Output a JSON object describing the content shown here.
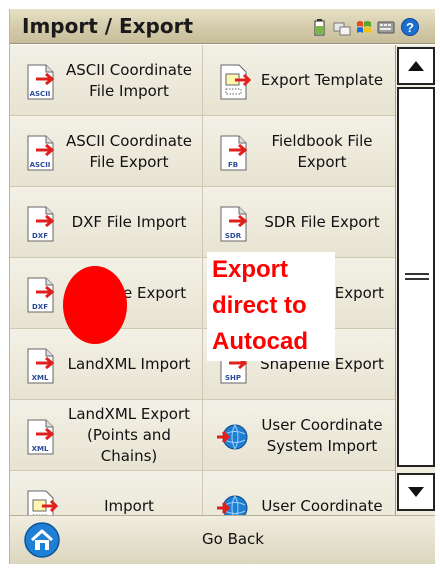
{
  "titlebar": {
    "title": "Import / Export",
    "icons": [
      "battery-icon",
      "network-icon",
      "windows-flag-icon",
      "keyboard-icon",
      "help-icon"
    ]
  },
  "grid": {
    "items": [
      {
        "label": "ASCII Coordinate File Import",
        "icon": "ascii-file-icon",
        "badge": "ASCII"
      },
      {
        "label": "Export Template",
        "icon": "template-icon",
        "badge": ""
      },
      {
        "label": "ASCII Coordinate File Export",
        "icon": "ascii-file-icon",
        "badge": "ASCII"
      },
      {
        "label": "Fieldbook File Export",
        "icon": "fieldbook-file-icon",
        "badge": "FB"
      },
      {
        "label": "DXF File Import",
        "icon": "dxf-file-icon",
        "badge": "DXF"
      },
      {
        "label": "SDR File Export",
        "icon": "sdr-file-icon",
        "badge": "SDR"
      },
      {
        "label": "DXF File Export",
        "icon": "dxf-file-icon",
        "badge": "DXF"
      },
      {
        "label": "Shapefile Export",
        "icon": "shp-file-icon",
        "badge": "SHP"
      },
      {
        "label": "LandXML Import",
        "icon": "xml-file-icon",
        "badge": "XML"
      },
      {
        "label": "Shapefile Export",
        "icon": "shp-file-icon",
        "badge": "SHP"
      },
      {
        "label": "LandXML Export (Points and Chains)",
        "icon": "xml-file-icon",
        "badge": "XML"
      },
      {
        "label": "User Coordinate System Import",
        "icon": "globe-import-icon",
        "badge": ""
      },
      {
        "label": "Import",
        "icon": "file-icon",
        "badge": ""
      },
      {
        "label": "User Coordinate",
        "icon": "globe-export-icon",
        "badge": ""
      }
    ]
  },
  "bottom": {
    "go_back_label": "Go Back"
  },
  "annotation": {
    "text_line1": "Export",
    "text_line2": "direct to",
    "text_line3": "Autocad",
    "color": "#ff0000"
  },
  "colors": {
    "titlebar": "#d4cbab",
    "cell": "#efece0",
    "arrow_red": "#e0201c",
    "globe_blue": "#1e7fd0"
  }
}
